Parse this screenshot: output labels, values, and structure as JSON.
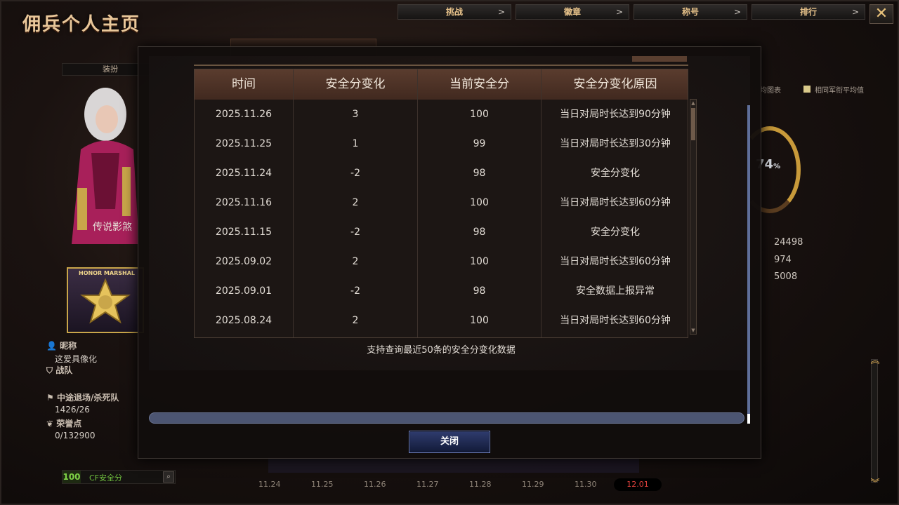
{
  "page": {
    "title": "佣兵个人主页",
    "nav": [
      {
        "label": "挑战",
        "chevron": ">"
      },
      {
        "label": "徽章",
        "chevron": ">"
      },
      {
        "label": "称号",
        "chevron": ">"
      },
      {
        "label": "排行",
        "chevron": ">"
      }
    ],
    "close_glyph": "✕",
    "outfit_label": "装扮",
    "character_name": "传说影煞",
    "rank_badge_text": "HONOR MARSHAL",
    "profile": {
      "nickname_label": "昵称",
      "nickname_value": "这爱具像化",
      "team_label": "战队",
      "quit_kill_label": "中途退场/杀死队",
      "quit_kill_value": "1426/26",
      "honor_label": "荣誉点",
      "honor_value": "0/132900"
    },
    "safety": {
      "score": "100",
      "label": "CF安全分"
    },
    "right_panel": {
      "legend_left": "均图表",
      "legend_right": "相同军衔平均值",
      "ring_percent": "74",
      "ring_unit": "%",
      "stats": [
        "24498",
        "974",
        "5008"
      ]
    },
    "dates": [
      "11.24",
      "11.25",
      "11.26",
      "11.27",
      "11.28",
      "11.29",
      "11.30",
      "12.01"
    ]
  },
  "modal": {
    "columns": [
      "时间",
      "安全分变化",
      "当前安全分",
      "安全分变化原因"
    ],
    "rows": [
      {
        "date": "2025.11.26",
        "change": "3",
        "current": "100",
        "reason": "当日对局时长达到90分钟"
      },
      {
        "date": "2025.11.25",
        "change": "1",
        "current": "99",
        "reason": "当日对局时长达到30分钟"
      },
      {
        "date": "2025.11.24",
        "change": "-2",
        "current": "98",
        "reason": "安全分变化"
      },
      {
        "date": "2025.11.16",
        "change": "2",
        "current": "100",
        "reason": "当日对局时长达到60分钟"
      },
      {
        "date": "2025.11.15",
        "change": "-2",
        "current": "98",
        "reason": "安全分变化"
      },
      {
        "date": "2025.09.02",
        "change": "2",
        "current": "100",
        "reason": "当日对局时长达到60分钟"
      },
      {
        "date": "2025.09.01",
        "change": "-2",
        "current": "98",
        "reason": "安全数据上报异常"
      },
      {
        "date": "2025.08.24",
        "change": "2",
        "current": "100",
        "reason": "当日对局时长达到60分钟"
      }
    ],
    "note": "支持查询最近50条的安全分变化数据",
    "close_label": "关闭"
  }
}
